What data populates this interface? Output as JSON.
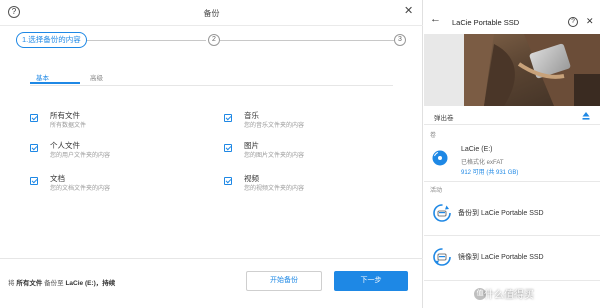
{
  "dialog": {
    "title": "备份",
    "help_glyph": "?",
    "close_glyph": "✕",
    "steps": [
      {
        "label": "1.选择备份的内容"
      },
      {
        "label": "2"
      },
      {
        "label": "3"
      }
    ],
    "tabs": [
      {
        "label": "基本",
        "active": true
      },
      {
        "label": "高级",
        "active": false
      }
    ],
    "options": [
      {
        "title": "所有文件",
        "subtitle": "所有数据文件",
        "checked": true
      },
      {
        "title": "个人文件",
        "subtitle": "您的用户文件夹的内容",
        "checked": true
      },
      {
        "title": "文档",
        "subtitle": "您的文档文件夹的内容",
        "checked": true
      },
      {
        "title": "音乐",
        "subtitle": "您的音乐文件夹的内容",
        "checked": true
      },
      {
        "title": "图片",
        "subtitle": "您的图片文件夹的内容",
        "checked": true
      },
      {
        "title": "视频",
        "subtitle": "您的视频文件夹的内容",
        "checked": true
      }
    ],
    "summary": {
      "prefix": "将",
      "what": "所有文件",
      "middle": "备份至",
      "target": "LaCie (E:)",
      "suffix": "，持续"
    },
    "start_button": "开始备份",
    "next_button": "下一步"
  },
  "panel": {
    "back_glyph": "←",
    "title": "LaCie Portable SSD",
    "help_glyph": "?",
    "close_glyph": "✕",
    "eject_label": "弹出卷",
    "volumes_label": "卷",
    "volume": {
      "name": "LaCie (E:)",
      "format": "已格式化 exFAT",
      "capacity": "912 可用 (共 931 GB)"
    },
    "activities_label": "活动",
    "actions": [
      {
        "label": "备份到 LaCie Portable SSD"
      },
      {
        "label": "镜像到 LaCie Portable SSD"
      }
    ],
    "accent_color": "#1e88e5"
  },
  "watermark": {
    "badge": "值",
    "text": "什么值得买"
  }
}
